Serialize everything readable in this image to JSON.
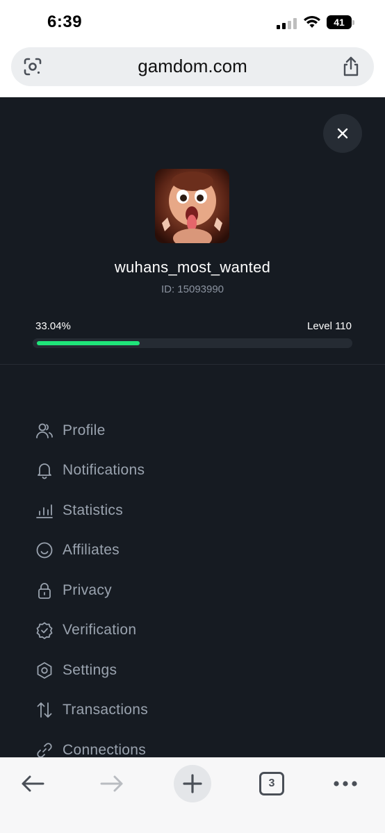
{
  "status_bar": {
    "time": "6:39",
    "battery": "41"
  },
  "browser": {
    "url": "gamdom.com"
  },
  "profile": {
    "username": "wuhans_most_wanted",
    "id_text": "ID: 15093990",
    "progress_text": "33.04%",
    "progress_value": 0.3304,
    "level_text": "Level 110"
  },
  "menu": {
    "items": [
      {
        "label": "Profile",
        "icon": "user-profile-icon"
      },
      {
        "label": "Notifications",
        "icon": "bell-icon"
      },
      {
        "label": "Statistics",
        "icon": "bar-chart-icon"
      },
      {
        "label": "Affiliates",
        "icon": "smiley-icon"
      },
      {
        "label": "Privacy",
        "icon": "lock-icon"
      },
      {
        "label": "Verification",
        "icon": "verified-badge-icon"
      },
      {
        "label": "Settings",
        "icon": "gear-icon"
      },
      {
        "label": "Transactions",
        "icon": "arrows-up-down-icon"
      },
      {
        "label": "Connections",
        "icon": "link-icon"
      }
    ]
  },
  "toolbar": {
    "tab_count": "3"
  },
  "colors": {
    "panel_bg": "#161b22",
    "accent_green": "#1fe57a",
    "menu_text": "#9aa3af"
  }
}
